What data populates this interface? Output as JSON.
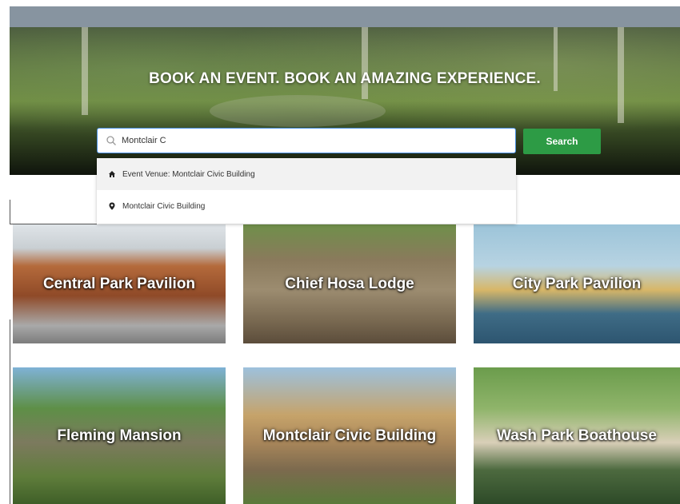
{
  "hero": {
    "title": "BOOK AN EVENT. BOOK AN AMAZING EXPERIENCE."
  },
  "search": {
    "value": "Montclair C",
    "button_label": "Search",
    "suggestions": [
      {
        "icon": "home-icon",
        "label": "Event Venue: Montclair Civic Building"
      },
      {
        "icon": "map-pin-icon",
        "label": "Montclair Civic Building"
      }
    ]
  },
  "venues": [
    {
      "name": "Central Park Pavilion"
    },
    {
      "name": "Chief Hosa Lodge"
    },
    {
      "name": "City Park Pavilion"
    },
    {
      "name": "Fleming Mansion"
    },
    {
      "name": "Montclair Civic Building"
    },
    {
      "name": "Wash Park Boathouse"
    }
  ],
  "colors": {
    "search_button": "#2d9b45",
    "input_border": "#4a90e2",
    "topbar": "#8794a0"
  }
}
